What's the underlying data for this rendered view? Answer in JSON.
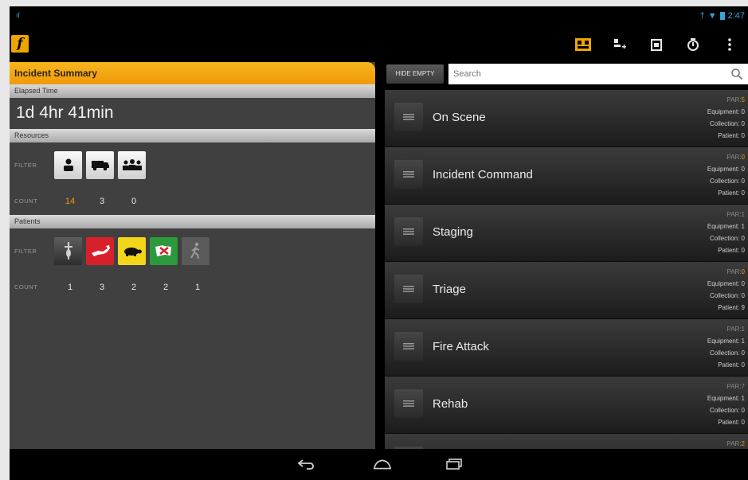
{
  "status_bar": {
    "left_indicator": "ıſ",
    "time": "2:47"
  },
  "action_bar": {
    "app_icon": "incident-logo-icon",
    "icons": [
      "qr-scan-icon",
      "add-unit-icon",
      "assign-icon",
      "timer-icon",
      "overflow-menu-icon"
    ]
  },
  "summary": {
    "title": "Incident Summary",
    "elapsed_label": "Elapsed Time",
    "elapsed_value": "1d 4hr 41min",
    "resources_label": "Resources",
    "resources_filter_label": "FILTER",
    "resources_count_label": "COUNT",
    "resources_counts": [
      "14",
      "3",
      "0"
    ],
    "patients_label": "Patients",
    "patients_filter_label": "FILTER",
    "patients_count_label": "COUNT",
    "patients_counts": [
      "1",
      "3",
      "2",
      "2",
      "1"
    ]
  },
  "toolbar": {
    "hide_empty_label": "HIDE EMPTY",
    "search_placeholder": "Search"
  },
  "groups": [
    {
      "name": "On Scene",
      "par_label": "PAR:",
      "par": "5",
      "equipment": "Equipment: 0",
      "collection": "Collection: 0",
      "patient": "Patient: 0"
    },
    {
      "name": "Incident Command",
      "par_label": "PAR:",
      "par": "0",
      "equipment": "Equipment: 0",
      "collection": "Collection: 0",
      "patient": "Patient: 0"
    },
    {
      "name": "Staging",
      "par_label": "PAR:",
      "par": "1",
      "equipment": "Equipment: 1",
      "collection": "Collection: 0",
      "patient": "Patient: 0"
    },
    {
      "name": "Triage",
      "par_label": "PAR:",
      "par": "0",
      "equipment": "Equipment: 0",
      "collection": "Collection: 0",
      "patient": "Patient: 9"
    },
    {
      "name": "Fire Attack",
      "par_label": "PAR:",
      "par": "1",
      "equipment": "Equipment: 1",
      "collection": "Collection: 0",
      "patient": "Patient: 0"
    },
    {
      "name": "Rehab",
      "par_label": "PAR:",
      "par": "7",
      "equipment": "Equipment: 1",
      "collection": "Collection: 0",
      "patient": "Patient: 0"
    },
    {
      "name": "",
      "par_label": "PAR:",
      "par": "2",
      "equipment": "",
      "collection": "",
      "patient": ""
    }
  ],
  "navbar": {
    "icons": [
      "back-icon",
      "home-icon",
      "recents-icon"
    ]
  }
}
